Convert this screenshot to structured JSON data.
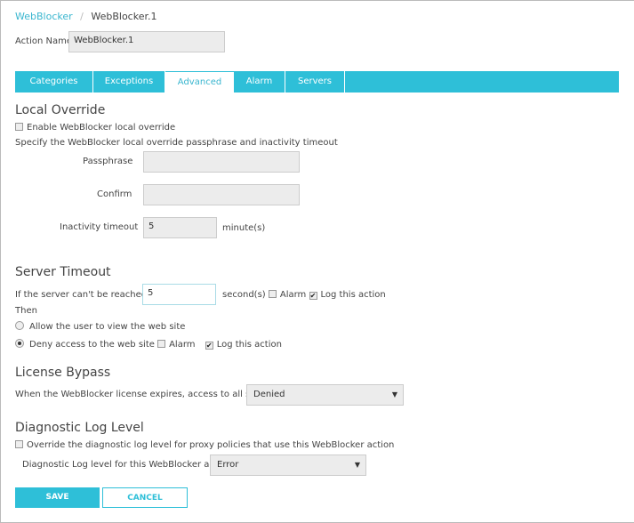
{
  "breadcrumb": {
    "root": "WebBlocker",
    "sep": "/",
    "current": "WebBlocker.1"
  },
  "action_name": {
    "label": "Action Name",
    "value": "WebBlocker.1"
  },
  "tabs": [
    "Categories",
    "Exceptions",
    "Advanced",
    "Alarm",
    "Servers"
  ],
  "local_override": {
    "title": "Local Override",
    "enable_label": "Enable WebBlocker local override",
    "description": "Specify the WebBlocker local override passphrase and inactivity timeout",
    "passphrase_label": "Passphrase",
    "confirm_label": "Confirm",
    "timeout_label": "Inactivity timeout",
    "timeout_value": "5",
    "timeout_unit": "minute(s)"
  },
  "server_timeout": {
    "title": "Server Timeout",
    "prefix": "If the server can't be reached in",
    "value": "5",
    "unit": "second(s)",
    "alarm": "Alarm",
    "log": "Log this action",
    "then": "Then",
    "allow": "Allow the user to view the web site",
    "deny": "Deny access to the web site",
    "deny_alarm": "Alarm",
    "deny_log": "Log this action"
  },
  "license": {
    "title": "License Bypass",
    "label": "When the WebBlocker license expires, access to all sites is",
    "value": "Denied"
  },
  "diagnostic": {
    "title": "Diagnostic Log Level",
    "override_label": "Override the diagnostic log level for proxy policies that use this WebBlocker action",
    "level_label": "Diagnostic Log level for this WebBlocker action",
    "level_value": "Error"
  },
  "buttons": {
    "save": "SAVE",
    "cancel": "CANCEL"
  },
  "colors": {
    "accent": "#2ebfd8"
  }
}
